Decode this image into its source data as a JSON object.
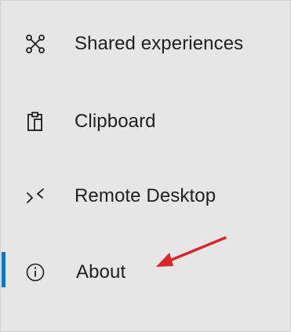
{
  "nav": {
    "items": [
      {
        "id": "shared",
        "label": "Shared experiences",
        "icon": "shared-experiences-icon"
      },
      {
        "id": "clipboard",
        "label": "Clipboard",
        "icon": "clipboard-icon"
      },
      {
        "id": "remote",
        "label": "Remote Desktop",
        "icon": "remote-desktop-icon"
      },
      {
        "id": "about",
        "label": "About",
        "icon": "info-icon",
        "selected": true
      }
    ]
  },
  "colors": {
    "accent": "#0078d7",
    "annotation_arrow": "#d9252b",
    "background": "#e6e6e6",
    "text": "#1f1f1f"
  }
}
